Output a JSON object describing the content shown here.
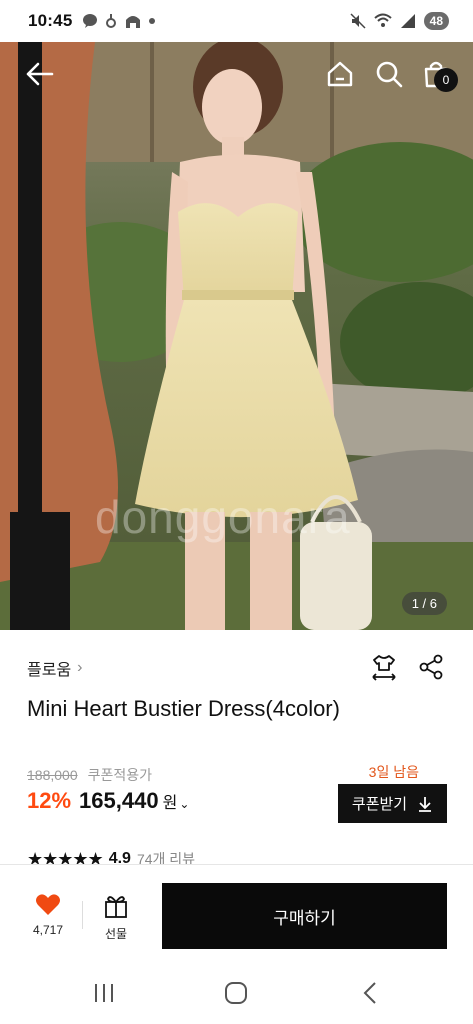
{
  "status_bar": {
    "time": "10:45",
    "battery": "48",
    "left_icons": [
      "chat-bubble-icon",
      "talk-icon",
      "notification-icon",
      "home-app-icon",
      "dot-icon"
    ],
    "right_icons": [
      "mute-icon",
      "wifi-icon",
      "signal-icon"
    ]
  },
  "hero": {
    "cart_count": "0",
    "image_counter": "1 / 6",
    "watermark": "donggonara"
  },
  "product": {
    "brand": "플로움",
    "brand_chevron": "›",
    "title": "Mini Heart Bustier Dress(4color)",
    "original_price": "188,000",
    "coupon_applied": "쿠폰적용가",
    "discount": "12%",
    "price": "165,440",
    "currency": "원",
    "currency_chevron": "⌄",
    "days_left": "3일 남음",
    "coupon_button": "쿠폰받기",
    "stars": "★★★★★",
    "rating": "4.9",
    "review_count": "74개 리뷰"
  },
  "bottom_bar": {
    "like_count": "4,717",
    "gift_label": "선물",
    "buy_button": "구매하기"
  },
  "colors": {
    "discount": "#ff4a10",
    "days_left": "#e2561b",
    "heart": "#f04a12",
    "button_bg": "#111111"
  }
}
